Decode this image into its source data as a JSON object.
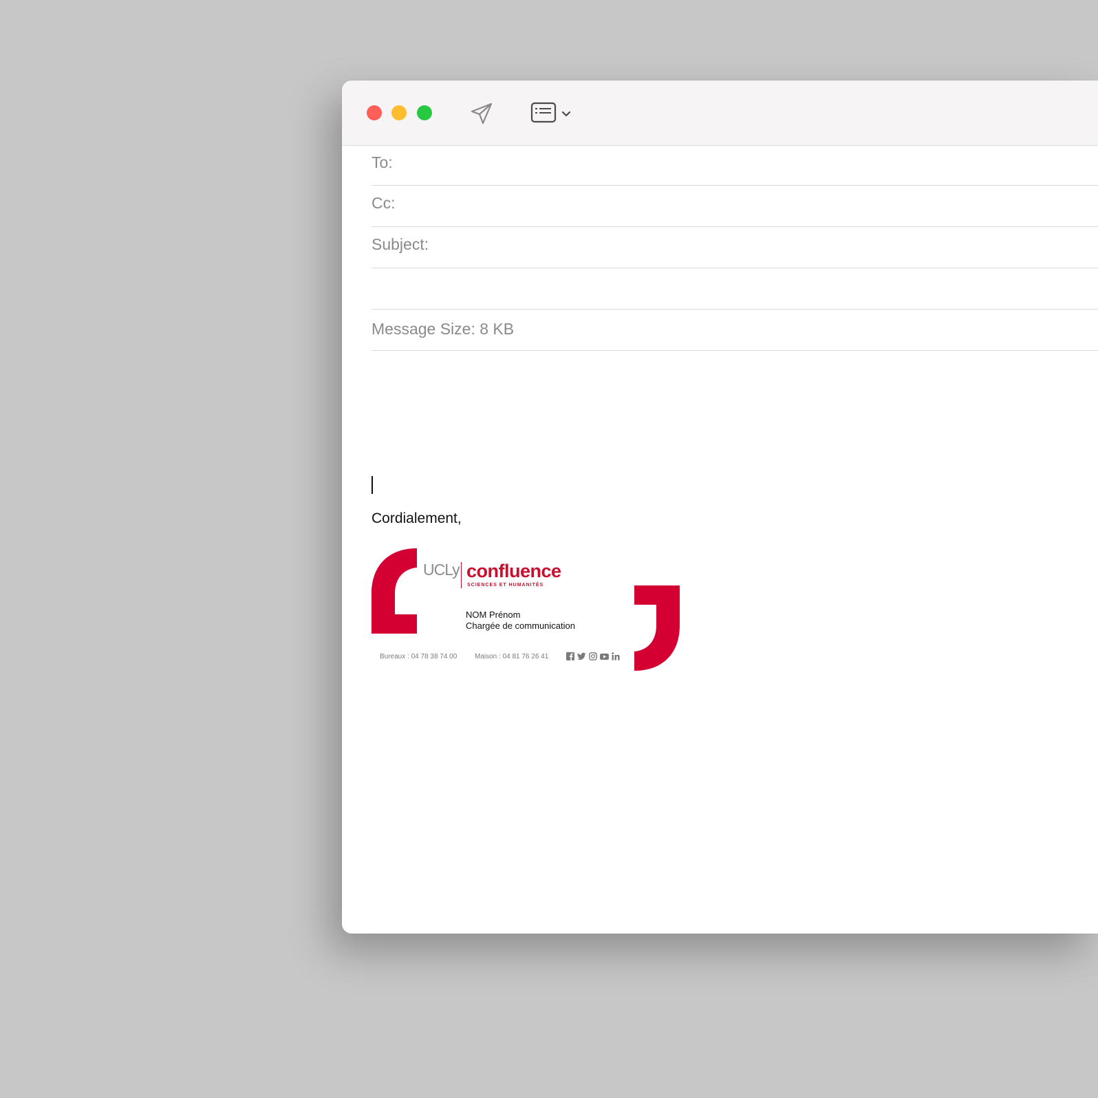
{
  "window": {
    "traffic_lights": {
      "close_color": "#fe5f57",
      "minimize_color": "#febc2e",
      "zoom_color": "#28c840"
    },
    "toolbar": {
      "send_icon": "paper-plane-icon",
      "format_icon": "header-fields-icon",
      "dropdown_icon": "chevron-down-icon"
    }
  },
  "compose": {
    "to_label": "To:",
    "to_value": "",
    "cc_label": "Cc:",
    "cc_value": "",
    "subject_label": "Subject:",
    "subject_value": "",
    "message_size_label": "Message Size: 8 KB"
  },
  "body": {
    "closing": "Cordialement,"
  },
  "signature": {
    "logo_left": "UCLy",
    "logo_right": "confluence",
    "logo_right_sub": "SCIENCES ET HUMANITÉS",
    "name": "NOM Prénom",
    "role": "Chargée de communication",
    "phone_office": "Bureaux : 04 78 38 74 00",
    "phone_home": "Maison : 04 81 76 26 41",
    "social_icons": [
      "facebook-icon",
      "twitter-icon",
      "instagram-icon",
      "youtube-icon",
      "linkedin-icon"
    ],
    "brand_color": "#d50032"
  }
}
